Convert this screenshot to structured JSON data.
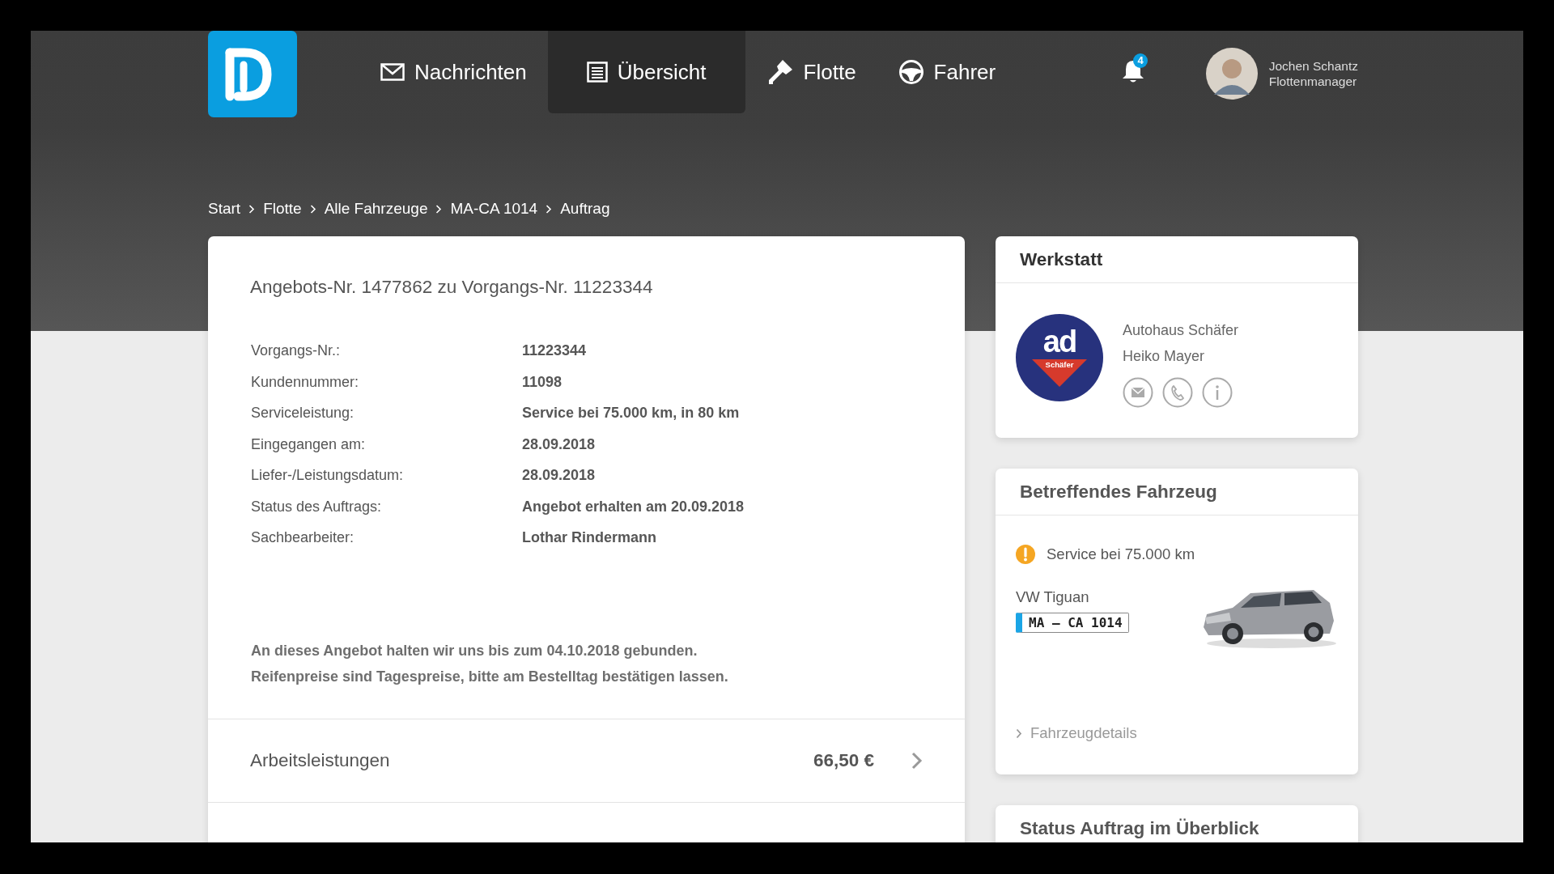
{
  "nav": [
    {
      "label": "Nachrichten",
      "kind": "mail",
      "selected": false
    },
    {
      "label": "Übersicht",
      "kind": "list",
      "selected": true
    },
    {
      "label": "Flotte",
      "kind": "key",
      "selected": false
    },
    {
      "label": "Fahrer",
      "kind": "wheel",
      "selected": false
    }
  ],
  "notifications": {
    "count": "4"
  },
  "user": {
    "name": "Jochen Schantz",
    "role": "Flottenmanager"
  },
  "breadcrumb": [
    "Start",
    "Flotte",
    "Alle Fahrzeuge",
    "MA-CA 1014",
    "Auftrag"
  ],
  "offer": {
    "title": "Angebots-Nr. 1477862 zu Vorgangs-Nr. 11223344",
    "fields": [
      {
        "label": "Vorgangs-Nr.:",
        "value": "11223344"
      },
      {
        "label": "Kundennummer:",
        "value": "11098"
      },
      {
        "label": "Serviceleistung:",
        "value": "Service bei 75.000 km, in 80 km"
      },
      {
        "label": "Eingegangen am:",
        "value": "28.09.2018"
      },
      {
        "label": "Liefer-/Leistungsdatum:",
        "value": "28.09.2018"
      },
      {
        "label": "Status des Auftrags:",
        "value": "Angebot erhalten am 20.09.2018"
      },
      {
        "label": "Sachbearbeiter:",
        "value": "Lothar Rindermann"
      }
    ],
    "notes": [
      "An dieses Angebot halten wir uns bis zum 04.10.2018 gebunden.",
      "Reifenpreise sind Tagespreise, bitte am Bestelltag bestätigen lassen."
    ],
    "positions": [
      {
        "label": "Arbeitsleistungen",
        "amount": "66,50 €"
      }
    ]
  },
  "workshop": {
    "title": "Werkstatt",
    "logo": {
      "mark": "ad",
      "banner": "Schäfer"
    },
    "name": "Autohaus Schäfer",
    "contact": "Heiko Mayer",
    "actions": [
      {
        "kind": "mail"
      },
      {
        "kind": "phone"
      },
      {
        "kind": "info"
      }
    ]
  },
  "vehicle": {
    "title": "Betreffendes Fahrzeug",
    "alert": "Service bei 75.000 km",
    "model": "VW Tiguan",
    "plate": "MA – CA 1014",
    "link": "Fahrzeugdetails"
  },
  "status": {
    "title": "Status Auftrag im Überblick"
  }
}
